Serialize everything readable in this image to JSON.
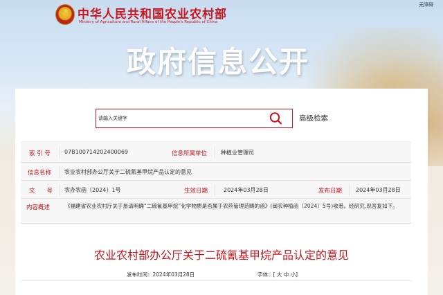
{
  "header": {
    "ministry_name_cn": "中华人民共和国农业农村部",
    "ministry_name_en": "Ministry of Agriculture and Rural Affairs of the People's Republic of China",
    "barrier_free_label": "无障碍",
    "headline": "政府信息公开"
  },
  "search": {
    "placeholder": "请输入关键字",
    "advanced_label": "高级检索",
    "icon": "search-icon"
  },
  "info": {
    "index_label": "索 引 号",
    "index_value": "07B100714202400069",
    "owner_label": "信息所属单位",
    "owner_value": "种植业管理司",
    "name_label": "信息名称",
    "name_value": "农业农村部办公厅关于二硫氰基甲烷产品认定的意见",
    "doc_label": "文　　号",
    "doc_value": "农办农函〔2024〕1号",
    "created_label": "生效日期",
    "created_value": "2024年03月28日",
    "published_label": "发布日期",
    "published_value": "2024年03月28日",
    "summary_label": "内容概述",
    "summary_value": "《福建省农业农村厅关于恳请明确“二硫氰基甲烷”化学物质是否属于农药管理范畴的函》(闽农种植函〔2024〕5号)收悉。经研究,现答复如下。"
  },
  "article": {
    "title": "农业农村部办公厅关于二硫氰基甲烷产品认定的意见",
    "date_text": "发布时间：2024年03月28日",
    "font_size_label": "字体：",
    "font_size_options": [
      "大",
      "中",
      "小"
    ]
  },
  "colors": {
    "brand_red": "#c8141c"
  }
}
